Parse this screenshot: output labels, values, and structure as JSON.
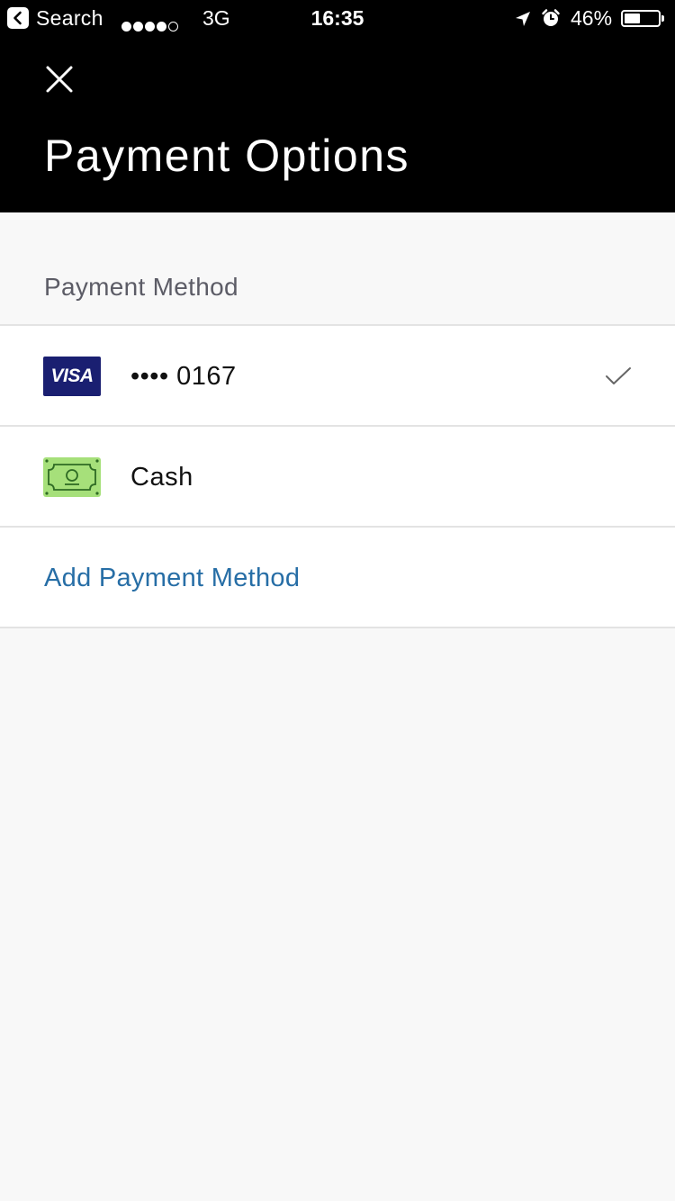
{
  "status_bar": {
    "back_label": "Search",
    "signal_dots_filled": 4,
    "signal_dots_total": 5,
    "network": "3G",
    "time": "16:35",
    "battery_percent_label": "46%",
    "battery_level": 0.46,
    "icons": [
      "back-arrow-icon",
      "location-arrow-icon",
      "alarm-icon",
      "battery-icon"
    ]
  },
  "header": {
    "close_icon": "close-icon",
    "title": "Payment Options"
  },
  "section": {
    "title": "Payment Method"
  },
  "payment_methods": [
    {
      "icon": "visa-card-icon",
      "icon_text": "VISA",
      "label": "•••• 0167",
      "selected": true
    },
    {
      "icon": "cash-icon",
      "label": "Cash",
      "selected": false
    }
  ],
  "add_payment": {
    "label": "Add Payment Method"
  },
  "colors": {
    "header_bg": "#000000",
    "page_bg": "#f8f8f8",
    "link": "#276ea6",
    "visa_blue": "#1a1f71",
    "cash_green": "#a6e07a",
    "cash_stroke": "#2f6b24",
    "divider": "#e3e3e3"
  }
}
